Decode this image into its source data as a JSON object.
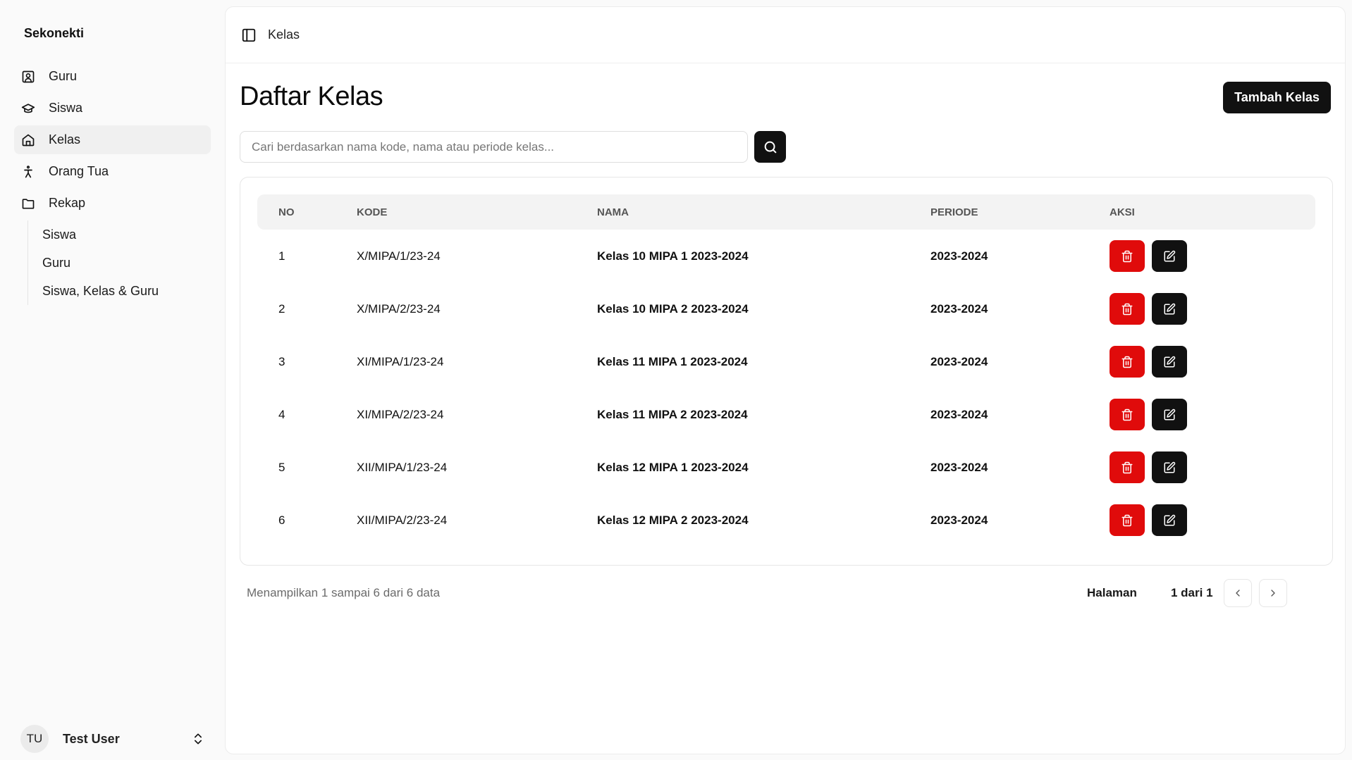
{
  "sidebar": {
    "brand": "Sekonekti",
    "items": [
      {
        "label": "Guru",
        "icon": "user-square-icon"
      },
      {
        "label": "Siswa",
        "icon": "graduation-cap-icon"
      },
      {
        "label": "Kelas",
        "icon": "home-icon"
      },
      {
        "label": "Orang Tua",
        "icon": "person-standing-icon"
      },
      {
        "label": "Rekap",
        "icon": "folder-icon"
      }
    ],
    "rekap_sub": [
      "Siswa",
      "Guru",
      "Siswa, Kelas & Guru"
    ],
    "user": {
      "initials": "TU",
      "name": "Test User"
    }
  },
  "header": {
    "breadcrumb": "Kelas"
  },
  "page": {
    "title": "Daftar Kelas",
    "add_button": "Tambah Kelas",
    "search_placeholder": "Cari berdasarkan nama kode, nama atau periode kelas..."
  },
  "table": {
    "headers": [
      "NO",
      "KODE",
      "NAMA",
      "PERIODE",
      "AKSI"
    ],
    "rows": [
      {
        "no": "1",
        "kode": "X/MIPA/1/23-24",
        "nama": "Kelas 10 MIPA 1 2023-2024",
        "periode": "2023-2024"
      },
      {
        "no": "2",
        "kode": "X/MIPA/2/23-24",
        "nama": "Kelas 10 MIPA 2 2023-2024",
        "periode": "2023-2024"
      },
      {
        "no": "3",
        "kode": "XI/MIPA/1/23-24",
        "nama": "Kelas 11 MIPA 1 2023-2024",
        "periode": "2023-2024"
      },
      {
        "no": "4",
        "kode": "XI/MIPA/2/23-24",
        "nama": "Kelas 11 MIPA 2 2023-2024",
        "periode": "2023-2024"
      },
      {
        "no": "5",
        "kode": "XII/MIPA/1/23-24",
        "nama": "Kelas 12 MIPA 1 2023-2024",
        "periode": "2023-2024"
      },
      {
        "no": "6",
        "kode": "XII/MIPA/2/23-24",
        "nama": "Kelas 12 MIPA 2 2023-2024",
        "periode": "2023-2024"
      }
    ]
  },
  "pagination": {
    "info": "Menampilkan 1 sampai 6 dari 6 data",
    "label": "Halaman",
    "page": "1 dari 1"
  },
  "colors": {
    "delete": "#e00b0b",
    "primary": "#111111"
  }
}
